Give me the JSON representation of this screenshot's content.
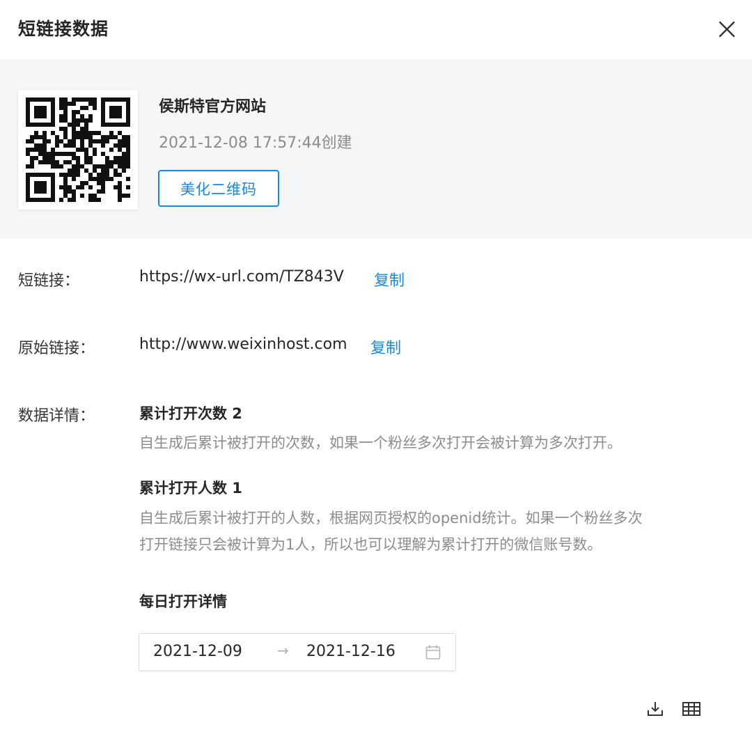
{
  "header": {
    "title": "短链接数据",
    "close_icon": "close-icon"
  },
  "card": {
    "qr_icon": "qr-code-icon",
    "site_name": "侯斯特官方网站",
    "created": "2021-12-08 17:57:44创建",
    "beautify_label": "美化二维码"
  },
  "short_link": {
    "label": "短链接：",
    "value": "https://wx-url.com/TZ843V",
    "copy_label": "复制"
  },
  "original_link": {
    "label": "原始链接：",
    "value": "http://www.weixinhost.com",
    "copy_label": "复制"
  },
  "details": {
    "label": "数据详情：",
    "opens_title": "累计打开次数 2",
    "opens_desc": "自生成后累计被打开的次数，如果一个粉丝多次打开会被计算为多次打开。",
    "users_title": "累计打开人数 1",
    "users_desc_line1": "自生成后累计被打开的人数，根据网页授权的openid统计。如果一个粉丝多次",
    "users_desc_line2": "打开链接只会被计算为1人，所以也可以理解为累计打开的微信账号数。",
    "daily_title": "每日打开详情"
  },
  "date_range": {
    "start": "2021-12-09",
    "separator": "→",
    "end": "2021-12-16",
    "icon": "calendar-icon"
  },
  "toolbar": {
    "download_icon": "download-icon",
    "table_icon": "table-icon"
  },
  "colors": {
    "accent": "#1a88d8",
    "muted_text": "#8c8c8c",
    "card_bg": "#f5f6f7"
  }
}
